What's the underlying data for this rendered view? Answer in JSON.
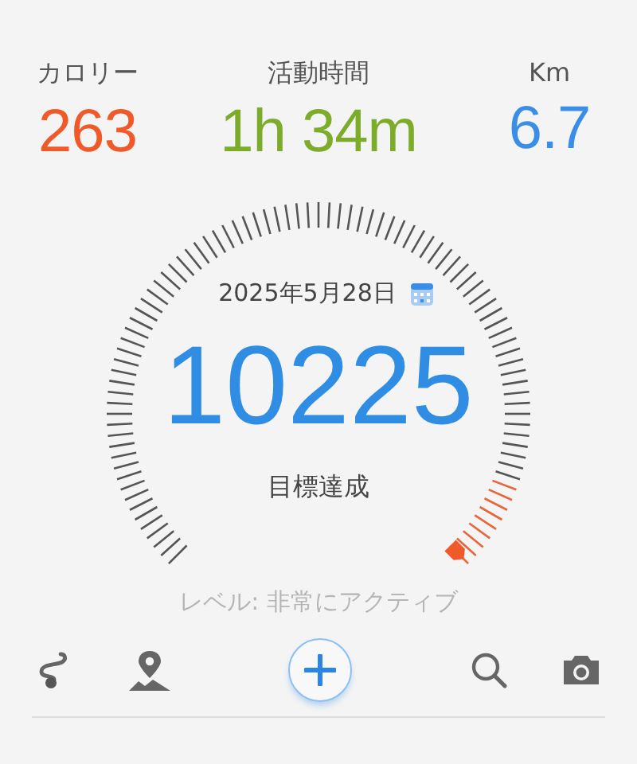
{
  "stats": [
    {
      "label": "カロリー",
      "value": "263",
      "color": "#f05a28"
    },
    {
      "label": "活動時間",
      "value": "1h 34m",
      "color": "#7cac2a"
    },
    {
      "label": "Km",
      "value": "6.7",
      "color": "#3a8ee6"
    }
  ],
  "gauge": {
    "date": "2025年5月28日",
    "steps": "10225",
    "caption": "目標達成"
  },
  "activity_level": "レベル: 非常にアクティブ",
  "toolbar": [
    {
      "kind": "route"
    },
    {
      "kind": "map"
    },
    {
      "kind": "add"
    },
    {
      "kind": "search"
    },
    {
      "kind": "camera"
    }
  ]
}
